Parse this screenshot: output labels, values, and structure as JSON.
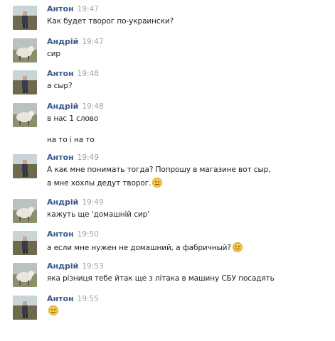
{
  "messages": [
    {
      "author": "Антон",
      "time": "19:47",
      "lines": [
        "Как будет творог по-украински?"
      ],
      "avatar": "anton"
    },
    {
      "author": "Андрій",
      "time": "19:47",
      "lines": [
        "сир"
      ],
      "avatar": "andriy"
    },
    {
      "author": "Антон",
      "time": "19:48",
      "lines": [
        "а сыр?"
      ],
      "avatar": "anton"
    },
    {
      "author": "Андрій",
      "time": "19:48",
      "lines": [
        "в нас 1 слово",
        "на то і на то"
      ],
      "avatar": "andriy"
    },
    {
      "author": "Антон",
      "time": "19:49",
      "lines": [
        "А как мне понимать тогда? Попрошу в магазине вот сыр,",
        "а мне хохлы дедут творог."
      ],
      "avatar": "anton",
      "emoji_after_line": 1,
      "emoji": "embarrassed-smiley"
    },
    {
      "author": "Андрій",
      "time": "19:49",
      "lines": [
        "кажуть ще 'домашній сир'"
      ],
      "avatar": "andriy"
    },
    {
      "author": "Антон",
      "time": "19:50",
      "lines": [
        "а если мне нужен не домашний, а фабричный?"
      ],
      "avatar": "anton",
      "emoji_after_line": 0,
      "emoji": "smiley"
    },
    {
      "author": "Андрій",
      "time": "19:53",
      "lines": [
        "яка різниця тебе йтак ще з літака в машину СБУ посадять"
      ],
      "avatar": "andriy"
    },
    {
      "author": "Антон",
      "time": "19:55",
      "lines": [
        ""
      ],
      "avatar": "anton",
      "emoji_after_line": 0,
      "emoji": "embarrassed-smiley"
    }
  ],
  "colors": {
    "author": "#3c5a8a",
    "time": "#9aa3ad",
    "text": "#1e1e1e",
    "emoji": "#f3c64a"
  }
}
